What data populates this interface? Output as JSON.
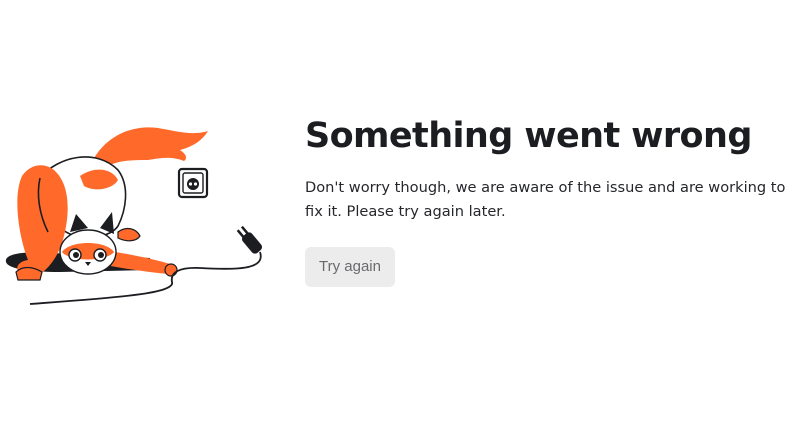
{
  "error": {
    "title": "Something went wrong",
    "message": "Don't worry though, we are aware of the issue and are working to fix it. Please try again later.",
    "retry_label": "Try again"
  },
  "illustration": {
    "subject": "cat pulling a power plug out of a wall socket",
    "colors": {
      "fur_orange": "#ff6a2b",
      "outline": "#1c1d21",
      "fur_white": "#ffffff"
    }
  }
}
